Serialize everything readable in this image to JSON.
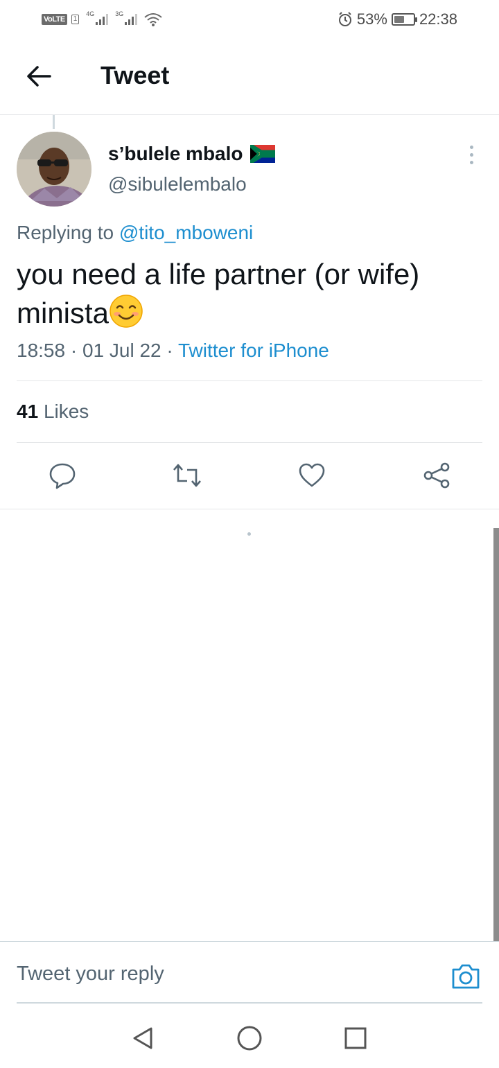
{
  "status_bar": {
    "volte": "VoLTE",
    "sim": "1",
    "net1": "4G",
    "net2": "3G",
    "battery": "53%",
    "battery_level": 0.53,
    "time": "22:38"
  },
  "header": {
    "title": "Tweet"
  },
  "tweet": {
    "author_name": "s’bulele mbalo",
    "author_handle": "@sibulelembalo",
    "replying_label": "Replying to",
    "replying_to": "@tito_mboweni",
    "text": "you need a life partner (or wife) minista",
    "time": "18:58",
    "date": "01 Jul 22",
    "source": "Twitter for iPhone",
    "likes_count": "41",
    "likes_label": "Likes"
  },
  "reply": {
    "placeholder": "Tweet your reply"
  },
  "colors": {
    "accent": "#1d8ecf",
    "secondary_text": "#536471",
    "divider": "#e4e6e8"
  }
}
